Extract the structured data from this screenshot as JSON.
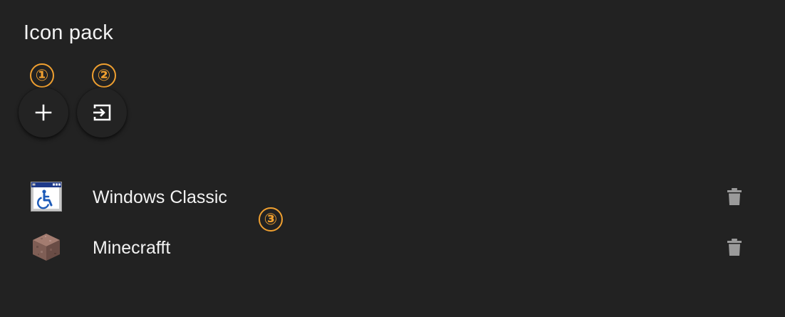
{
  "header": {
    "title": "Icon pack"
  },
  "markers": [
    "①",
    "②",
    "③"
  ],
  "actions": [
    {
      "icon": "plus-icon"
    },
    {
      "icon": "import-icon"
    }
  ],
  "icon_packs": [
    {
      "label": "Windows Classic",
      "icon": "windows-classic-accessibility-icon"
    },
    {
      "label": "Minecrafft",
      "icon": "minecraft-block-icon"
    }
  ],
  "colors": {
    "background": "#222222",
    "text": "#f2f2f2",
    "marker": "#f0a030",
    "trash": "#9a9a9a"
  }
}
